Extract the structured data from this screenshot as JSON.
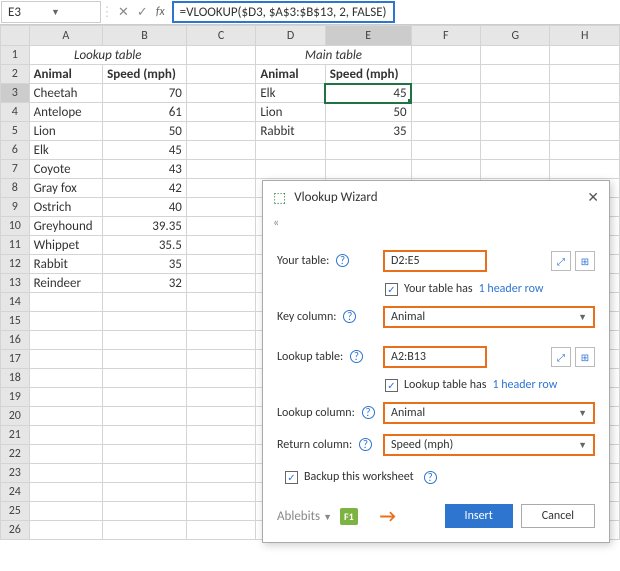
{
  "formula_bar": {
    "cell_ref": "E3",
    "cancel": "✕",
    "confirm": "✓",
    "fx": "fx",
    "formula": "=VLOOKUP($D3, $A$3:$B$13, 2, FALSE)"
  },
  "columns": [
    "",
    "A",
    "B",
    "C",
    "D",
    "E",
    "F",
    "G",
    "H"
  ],
  "row_headers": [
    "1",
    "2",
    "3",
    "4",
    "5",
    "6",
    "7",
    "8",
    "9",
    "10",
    "11",
    "12",
    "13",
    "14",
    "15",
    "16",
    "17",
    "18",
    "19",
    "20",
    "21",
    "22",
    "23",
    "24",
    "25",
    "26"
  ],
  "lookup_title": "Lookup table",
  "main_title": "Main table",
  "lookup_headers": {
    "animal": "Animal",
    "speed": "Speed (mph)"
  },
  "main_headers": {
    "animal": "Animal",
    "speed": "Speed (mph)"
  },
  "lookup_data": [
    {
      "a": "Cheetah",
      "b": "70"
    },
    {
      "a": "Antelope",
      "b": "61"
    },
    {
      "a": "Lion",
      "b": "50"
    },
    {
      "a": "Elk",
      "b": "45"
    },
    {
      "a": "Coyote",
      "b": "43"
    },
    {
      "a": "Gray fox",
      "b": "42"
    },
    {
      "a": "Ostrich",
      "b": "40"
    },
    {
      "a": "Greyhound",
      "b": "39.35"
    },
    {
      "a": "Whippet",
      "b": "35.5"
    },
    {
      "a": "Rabbit",
      "b": "35"
    },
    {
      "a": "Reindeer",
      "b": "32"
    }
  ],
  "main_data": [
    {
      "a": "Elk",
      "b": "45"
    },
    {
      "a": "Lion",
      "b": "50"
    },
    {
      "a": "Rabbit",
      "b": "35"
    }
  ],
  "dialog": {
    "title": "Vlookup Wizard",
    "collapse": "«",
    "your_table_lbl": "Your table:",
    "your_table_val": "D2:E5",
    "your_table_chk": "Your table has",
    "header_link": "1 header row",
    "key_col_lbl": "Key column:",
    "key_col_val": "Animal",
    "lookup_table_lbl": "Lookup table:",
    "lookup_table_val": "A2:B13",
    "lookup_table_chk": "Lookup table has",
    "lookup_col_lbl": "Lookup column:",
    "lookup_col_val": "Animal",
    "return_col_lbl": "Return column:",
    "return_col_val": "Speed (mph)",
    "backup_lbl": "Backup this worksheet",
    "brand": "Ablebits",
    "f1": "F1",
    "insert": "Insert",
    "cancel": "Cancel"
  }
}
